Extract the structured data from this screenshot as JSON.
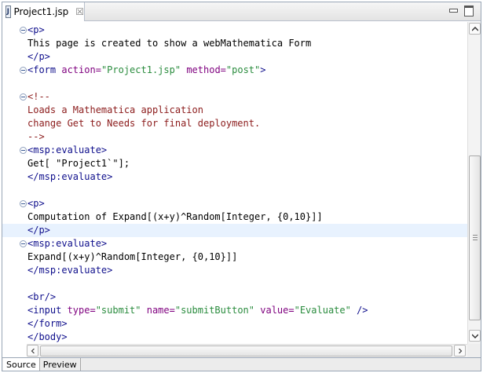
{
  "editor": {
    "tab_title": "Project1.jsp",
    "tab_icon": "jsp-file-icon",
    "tab_icon_letter": "J",
    "close_glyph": "☒"
  },
  "code_lines": [
    {
      "fold": true,
      "segments": [
        {
          "t": "tag",
          "v": "<p>"
        }
      ]
    },
    {
      "fold": false,
      "segments": [
        {
          "t": "txt",
          "v": "This page is created to show a webMathematica Form"
        }
      ]
    },
    {
      "fold": false,
      "segments": [
        {
          "t": "tag",
          "v": "</p>"
        }
      ]
    },
    {
      "fold": true,
      "segments": [
        {
          "t": "tag",
          "v": "<form "
        },
        {
          "t": "attr",
          "v": "action="
        },
        {
          "t": "str",
          "v": "\"Project1.jsp\""
        },
        {
          "t": "attr",
          "v": " method="
        },
        {
          "t": "str",
          "v": "\"post\""
        },
        {
          "t": "tag",
          "v": ">"
        }
      ]
    },
    {
      "fold": false,
      "segments": []
    },
    {
      "fold": true,
      "segments": [
        {
          "t": "cmt",
          "v": "<!--"
        }
      ]
    },
    {
      "fold": false,
      "segments": [
        {
          "t": "cmt",
          "v": "Loads a Mathematica application"
        }
      ]
    },
    {
      "fold": false,
      "segments": [
        {
          "t": "cmt",
          "v": "change Get to Needs for final deployment."
        }
      ]
    },
    {
      "fold": false,
      "segments": [
        {
          "t": "cmt",
          "v": "-->"
        }
      ]
    },
    {
      "fold": true,
      "segments": [
        {
          "t": "tag",
          "v": "<msp:evaluate>"
        }
      ]
    },
    {
      "fold": false,
      "segments": [
        {
          "t": "txt",
          "v": "Get[ \"Project1`\"];"
        }
      ]
    },
    {
      "fold": false,
      "segments": [
        {
          "t": "tag",
          "v": "</msp:evaluate>"
        }
      ]
    },
    {
      "fold": false,
      "segments": []
    },
    {
      "fold": true,
      "segments": [
        {
          "t": "tag",
          "v": "<p>"
        }
      ]
    },
    {
      "fold": false,
      "segments": [
        {
          "t": "txt",
          "v": "Computation of Expand[(x+y)^Random[Integer, {0,10}]]"
        }
      ]
    },
    {
      "fold": false,
      "current": true,
      "segments": [
        {
          "t": "tag",
          "v": "</p>"
        }
      ]
    },
    {
      "fold": true,
      "segments": [
        {
          "t": "tag",
          "v": "<msp:evaluate>"
        }
      ]
    },
    {
      "fold": false,
      "segments": [
        {
          "t": "txt",
          "v": "Expand[(x+y)^Random[Integer, {0,10}]]"
        }
      ]
    },
    {
      "fold": false,
      "segments": [
        {
          "t": "tag",
          "v": "</msp:evaluate>"
        }
      ]
    },
    {
      "fold": false,
      "segments": []
    },
    {
      "fold": false,
      "segments": [
        {
          "t": "tag",
          "v": "<br/>"
        }
      ]
    },
    {
      "fold": false,
      "segments": [
        {
          "t": "tag",
          "v": "<input "
        },
        {
          "t": "attr",
          "v": "type="
        },
        {
          "t": "str",
          "v": "\"submit\""
        },
        {
          "t": "attr",
          "v": " name="
        },
        {
          "t": "str",
          "v": "\"submitButton\""
        },
        {
          "t": "attr",
          "v": " value="
        },
        {
          "t": "str",
          "v": "\"Evaluate\""
        },
        {
          "t": "tag",
          "v": " />"
        }
      ]
    },
    {
      "fold": false,
      "segments": [
        {
          "t": "tag",
          "v": "</form>"
        }
      ]
    },
    {
      "fold": false,
      "segments": [
        {
          "t": "tag",
          "v": "</body>"
        }
      ]
    }
  ],
  "bottom_tabs": [
    {
      "label": "Source",
      "active": true
    },
    {
      "label": "Preview",
      "active": false
    }
  ],
  "colors": {
    "tag": "#0f0f8c",
    "attribute": "#7f007f",
    "string": "#2a8c3e",
    "comment": "#8c1c1c",
    "current_line": "#e8f2fe"
  }
}
